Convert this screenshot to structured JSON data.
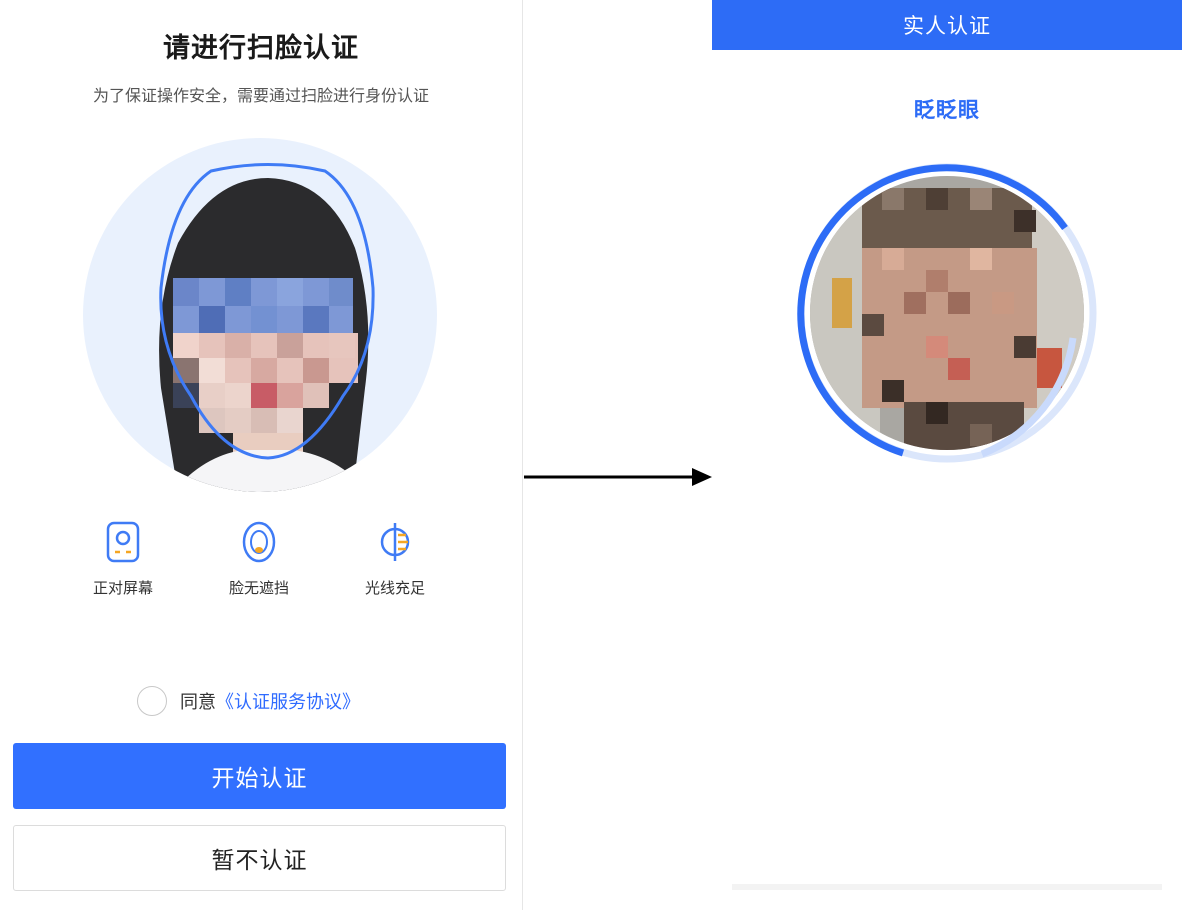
{
  "left": {
    "title": "请进行扫脸认证",
    "subtitle": "为了保证操作安全，需要通过扫脸进行身份认证",
    "tips": [
      {
        "icon": "phone-face-icon",
        "label": "正对屏幕"
      },
      {
        "icon": "face-outline-icon",
        "label": "脸无遮挡"
      },
      {
        "icon": "light-bulb-icon",
        "label": "光线充足"
      }
    ],
    "agree_prefix": "同意",
    "agree_link": "《认证服务协议》",
    "start_button": "开始认证",
    "skip_button": "暂不认证"
  },
  "right": {
    "header_title": "实人认证",
    "prompt": "眨眨眼"
  },
  "colors": {
    "primary": "#3170ff",
    "header": "#2d6cf6",
    "link": "#2f6bff",
    "circle_bg": "#e9f1fd"
  }
}
